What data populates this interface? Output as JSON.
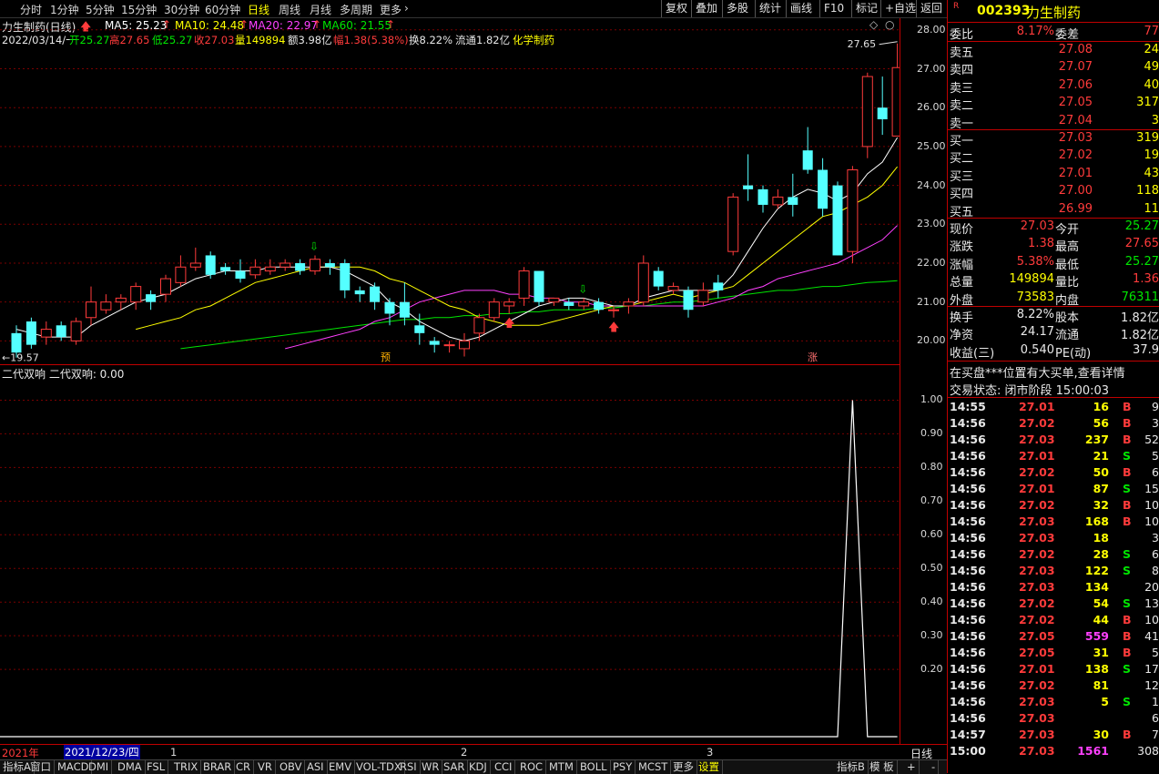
{
  "periods": [
    "分时",
    "1分钟",
    "5分钟",
    "15分钟",
    "30分钟",
    "60分钟",
    "日线",
    "周线",
    "月线",
    "多周期",
    "更多"
  ],
  "active_period": "日线",
  "tools": [
    "复权",
    "叠加",
    "多股",
    "统计",
    "画线",
    "F10",
    "标记",
    "+自选",
    "返回"
  ],
  "stock": {
    "code": "002393",
    "name": "力生制药",
    "badge": "R",
    "title": "力生制药(日线)"
  },
  "ma_line": {
    "ma5": "MA5: 25.23",
    "ma10": "MA10: 24.48",
    "ma20": "MA20: 22.97",
    "ma60": "MA60: 21.55"
  },
  "info_line": {
    "date": "2022/03/14/一",
    "open": "开25.27",
    "high": "高27.65",
    "low": "低25.27",
    "close": "收27.03",
    "vol": "量149894",
    "amt": "额3.98亿",
    "chg": "幅1.38(5.38%)",
    "turn": "换8.22%",
    "float": "流通1.82亿",
    "sector": "化学制药"
  },
  "kline_axis": [
    "28.00",
    "27.00",
    "26.00",
    "25.00",
    "24.00",
    "23.00",
    "22.00",
    "21.00",
    "20.00"
  ],
  "kline_annotations": {
    "high_label": "27.65",
    "low_label": "19.57",
    "pre": "预",
    "rise": "涨"
  },
  "indicator": {
    "title": "二代双响  二代双响: 0.00",
    "axis": [
      "1.00",
      "0.90",
      "0.80",
      "0.70",
      "0.60",
      "0.50",
      "0.40",
      "0.30",
      "0.20"
    ]
  },
  "date_bar": {
    "year": "2021年",
    "cursor_date": "2021/12/23/四",
    "m1": "1",
    "m2": "2",
    "m3": "3",
    "period": "日线"
  },
  "bottom_tabs": [
    "指标A",
    "窗口",
    "MACD",
    "DMI",
    "DMA",
    "FSL",
    "TRIX",
    "BRAR",
    "CR",
    "VR",
    "OBV",
    "ASI",
    "EMV",
    "VOL-TDX",
    "RSI",
    "WR",
    "SAR",
    "KDJ",
    "CCI",
    "ROC",
    "MTM",
    "BOLL",
    "PSY",
    "MCST",
    "更多",
    "设置"
  ],
  "bottom_right": [
    "指标B",
    "模 板",
    "+",
    "-"
  ],
  "order_book": {
    "weibi_label": "委比",
    "weibi": "8.17%",
    "weicha_label": "委差",
    "weicha": "77",
    "asks": [
      {
        "l": "卖五",
        "p": "27.08",
        "v": "24"
      },
      {
        "l": "卖四",
        "p": "27.07",
        "v": "49"
      },
      {
        "l": "卖三",
        "p": "27.06",
        "v": "40"
      },
      {
        "l": "卖二",
        "p": "27.05",
        "v": "317"
      },
      {
        "l": "卖一",
        "p": "27.04",
        "v": "3"
      }
    ],
    "bids": [
      {
        "l": "买一",
        "p": "27.03",
        "v": "319"
      },
      {
        "l": "买二",
        "p": "27.02",
        "v": "19"
      },
      {
        "l": "买三",
        "p": "27.01",
        "v": "43"
      },
      {
        "l": "买四",
        "p": "27.00",
        "v": "118"
      },
      {
        "l": "买五",
        "p": "26.99",
        "v": "11"
      }
    ]
  },
  "quote": [
    {
      "l1": "现价",
      "v1": "27.03",
      "l2": "今开",
      "v2": "25.27"
    },
    {
      "l1": "涨跌",
      "v1": "1.38",
      "l2": "最高",
      "v2": "27.65"
    },
    {
      "l1": "涨幅",
      "v1": "5.38%",
      "l2": "最低",
      "v2": "25.27"
    },
    {
      "l1": "总量",
      "v1": "149894",
      "l2": "量比",
      "v2": "1.36"
    },
    {
      "l1": "外盘",
      "v1": "73583",
      "l2": "内盘",
      "v2": "76311"
    }
  ],
  "fund": [
    {
      "l1": "换手",
      "v1": "8.22%",
      "l2": "股本",
      "v2": "1.82亿"
    },
    {
      "l1": "净资",
      "v1": "24.17",
      "l2": "流通",
      "v2": "1.82亿"
    },
    {
      "l1": "收益(三)",
      "v1": "0.540",
      "l2": "PE(动)",
      "v2": "37.9"
    }
  ],
  "notice": "在买盘***位置有大买单,查看详情",
  "trade_status": "交易状态: 闭市阶段 15:00:03",
  "ticks": [
    {
      "t": "14:55",
      "p": "27.01",
      "v": "16",
      "d": "B",
      "n": "9"
    },
    {
      "t": "14:56",
      "p": "27.02",
      "v": "56",
      "d": "B",
      "n": "3"
    },
    {
      "t": "14:56",
      "p": "27.03",
      "v": "237",
      "d": "B",
      "n": "52"
    },
    {
      "t": "14:56",
      "p": "27.01",
      "v": "21",
      "d": "S",
      "n": "5"
    },
    {
      "t": "14:56",
      "p": "27.02",
      "v": "50",
      "d": "B",
      "n": "6"
    },
    {
      "t": "14:56",
      "p": "27.01",
      "v": "87",
      "d": "S",
      "n": "15"
    },
    {
      "t": "14:56",
      "p": "27.02",
      "v": "32",
      "d": "B",
      "n": "10"
    },
    {
      "t": "14:56",
      "p": "27.03",
      "v": "168",
      "d": "B",
      "n": "10"
    },
    {
      "t": "14:56",
      "p": "27.03",
      "v": "18",
      "d": "",
      "n": "3"
    },
    {
      "t": "14:56",
      "p": "27.02",
      "v": "28",
      "d": "S",
      "n": "6"
    },
    {
      "t": "14:56",
      "p": "27.03",
      "v": "122",
      "d": "S",
      "n": "8"
    },
    {
      "t": "14:56",
      "p": "27.03",
      "v": "134",
      "d": "",
      "n": "20"
    },
    {
      "t": "14:56",
      "p": "27.02",
      "v": "54",
      "d": "S",
      "n": "13"
    },
    {
      "t": "14:56",
      "p": "27.02",
      "v": "44",
      "d": "B",
      "n": "10"
    },
    {
      "t": "14:56",
      "p": "27.05",
      "v": "559",
      "d": "B",
      "n": "41"
    },
    {
      "t": "14:56",
      "p": "27.05",
      "v": "31",
      "d": "B",
      "n": "5"
    },
    {
      "t": "14:56",
      "p": "27.01",
      "v": "138",
      "d": "S",
      "n": "17"
    },
    {
      "t": "14:56",
      "p": "27.02",
      "v": "81",
      "d": "",
      "n": "12"
    },
    {
      "t": "14:56",
      "p": "27.03",
      "v": "5",
      "d": "S",
      "n": "1"
    },
    {
      "t": "14:56",
      "p": "27.03",
      "v": "",
      "d": "",
      "n": "6"
    },
    {
      "t": "14:57",
      "p": "27.03",
      "v": "30",
      "d": "B",
      "n": "7"
    },
    {
      "t": "15:00",
      "p": "27.03",
      "v": "1561",
      "d": "",
      "n": "308"
    }
  ],
  "colors": {
    "up": "#ff3b3b",
    "down": "#54ffff",
    "ma5": "#ffffff",
    "ma10": "#ffff00",
    "ma20": "#ff40ff",
    "ma60": "#00e600"
  },
  "chart_data": {
    "type": "candlestick",
    "title": "力生制药(日线)",
    "ylim": [
      19.4,
      28.3
    ],
    "candles": [
      {
        "o": 20.2,
        "c": 19.7,
        "h": 20.4,
        "l": 19.57
      },
      {
        "o": 20.5,
        "c": 19.9,
        "h": 20.6,
        "l": 19.8
      },
      {
        "o": 20.1,
        "c": 20.3,
        "h": 20.5,
        "l": 19.9
      },
      {
        "o": 20.4,
        "c": 20.1,
        "h": 20.5,
        "l": 20.0
      },
      {
        "o": 20.0,
        "c": 20.5,
        "h": 20.6,
        "l": 19.9
      },
      {
        "o": 20.6,
        "c": 21.0,
        "h": 21.4,
        "l": 20.4
      },
      {
        "o": 20.8,
        "c": 21.0,
        "h": 21.2,
        "l": 20.7
      },
      {
        "o": 21.0,
        "c": 21.1,
        "h": 21.2,
        "l": 20.8
      },
      {
        "o": 21.0,
        "c": 21.4,
        "h": 21.5,
        "l": 20.8
      },
      {
        "o": 21.2,
        "c": 21.0,
        "h": 21.3,
        "l": 20.8
      },
      {
        "o": 21.2,
        "c": 21.6,
        "h": 21.7,
        "l": 21.0
      },
      {
        "o": 21.5,
        "c": 21.9,
        "h": 22.2,
        "l": 21.4
      },
      {
        "o": 21.9,
        "c": 22.0,
        "h": 22.4,
        "l": 21.8
      },
      {
        "o": 22.2,
        "c": 21.7,
        "h": 22.3,
        "l": 21.6
      },
      {
        "o": 21.9,
        "c": 21.8,
        "h": 22.0,
        "l": 21.7
      },
      {
        "o": 21.8,
        "c": 21.6,
        "h": 22.1,
        "l": 21.5
      },
      {
        "o": 21.7,
        "c": 21.9,
        "h": 22.1,
        "l": 21.6
      },
      {
        "o": 21.8,
        "c": 21.9,
        "h": 22.1,
        "l": 21.7
      },
      {
        "o": 21.9,
        "c": 22.0,
        "h": 22.1,
        "l": 21.8
      },
      {
        "o": 22.0,
        "c": 21.8,
        "h": 22.1,
        "l": 21.7
      },
      {
        "o": 21.8,
        "c": 22.1,
        "h": 22.2,
        "l": 21.7
      },
      {
        "o": 22.0,
        "c": 21.9,
        "h": 22.1,
        "l": 21.7
      },
      {
        "o": 22.0,
        "c": 21.3,
        "h": 22.1,
        "l": 21.1
      },
      {
        "o": 21.3,
        "c": 21.2,
        "h": 21.4,
        "l": 21.0
      },
      {
        "o": 21.4,
        "c": 21.0,
        "h": 21.5,
        "l": 20.8
      },
      {
        "o": 21.0,
        "c": 20.7,
        "h": 21.1,
        "l": 20.4
      },
      {
        "o": 21.0,
        "c": 20.6,
        "h": 21.5,
        "l": 20.4
      },
      {
        "o": 20.4,
        "c": 20.2,
        "h": 20.7,
        "l": 19.9
      },
      {
        "o": 20.0,
        "c": 19.9,
        "h": 20.1,
        "l": 19.7
      },
      {
        "o": 19.9,
        "c": 19.9,
        "h": 20.0,
        "l": 19.7
      },
      {
        "o": 19.8,
        "c": 20.0,
        "h": 20.2,
        "l": 19.6
      },
      {
        "o": 20.2,
        "c": 20.6,
        "h": 20.7,
        "l": 20.0
      },
      {
        "o": 20.6,
        "c": 21.0,
        "h": 21.1,
        "l": 20.5
      },
      {
        "o": 20.9,
        "c": 21.0,
        "h": 21.1,
        "l": 20.7
      },
      {
        "o": 21.1,
        "c": 21.8,
        "h": 21.9,
        "l": 20.9
      },
      {
        "o": 21.8,
        "c": 21.0,
        "h": 21.8,
        "l": 20.9
      },
      {
        "o": 21.0,
        "c": 21.1,
        "h": 21.1,
        "l": 20.9
      },
      {
        "o": 21.0,
        "c": 20.9,
        "h": 21.1,
        "l": 20.8
      },
      {
        "o": 20.9,
        "c": 21.0,
        "h": 21.1,
        "l": 20.8
      },
      {
        "o": 21.0,
        "c": 20.8,
        "h": 21.1,
        "l": 20.7
      },
      {
        "o": 20.8,
        "c": 20.8,
        "h": 20.9,
        "l": 20.6
      },
      {
        "o": 20.9,
        "c": 21.0,
        "h": 21.1,
        "l": 20.7
      },
      {
        "o": 21.0,
        "c": 22.0,
        "h": 22.2,
        "l": 20.9
      },
      {
        "o": 21.8,
        "c": 21.4,
        "h": 21.9,
        "l": 21.3
      },
      {
        "o": 21.3,
        "c": 21.4,
        "h": 21.5,
        "l": 21.2
      },
      {
        "o": 21.3,
        "c": 20.8,
        "h": 21.4,
        "l": 20.6
      },
      {
        "o": 21.0,
        "c": 21.3,
        "h": 21.5,
        "l": 20.9
      },
      {
        "o": 21.5,
        "c": 21.3,
        "h": 21.7,
        "l": 21.1
      },
      {
        "o": 22.3,
        "c": 23.7,
        "h": 23.8,
        "l": 22.2
      },
      {
        "o": 24.0,
        "c": 23.9,
        "h": 24.8,
        "l": 23.6
      },
      {
        "o": 23.9,
        "c": 23.5,
        "h": 24.0,
        "l": 23.3
      },
      {
        "o": 23.5,
        "c": 23.7,
        "h": 23.9,
        "l": 23.4
      },
      {
        "o": 23.7,
        "c": 23.5,
        "h": 24.3,
        "l": 23.2
      },
      {
        "o": 24.9,
        "c": 24.4,
        "h": 25.5,
        "l": 24.3
      },
      {
        "o": 24.4,
        "c": 23.4,
        "h": 24.7,
        "l": 23.2
      },
      {
        "o": 24.0,
        "c": 22.2,
        "h": 24.1,
        "l": 22.2
      },
      {
        "o": 22.3,
        "c": 24.4,
        "h": 24.5,
        "l": 22.0
      },
      {
        "o": 25.0,
        "c": 26.8,
        "h": 26.9,
        "l": 24.7
      },
      {
        "o": 26.0,
        "c": 25.7,
        "h": 26.8,
        "l": 25.3
      },
      {
        "o": 25.27,
        "c": 27.03,
        "h": 27.65,
        "l": 25.27
      }
    ],
    "ma5": [
      20.3,
      20.2,
      20.1,
      20.1,
      20.1,
      20.4,
      20.6,
      20.8,
      21.0,
      21.1,
      21.2,
      21.4,
      21.6,
      21.7,
      21.8,
      21.8,
      21.8,
      21.9,
      21.9,
      21.9,
      21.9,
      21.9,
      21.8,
      21.6,
      21.4,
      21.0,
      20.8,
      20.5,
      20.3,
      20.1,
      20.0,
      20.1,
      20.3,
      20.5,
      20.7,
      20.9,
      21.0,
      21.1,
      21.1,
      21.0,
      20.9,
      20.9,
      21.1,
      21.2,
      21.3,
      21.3,
      21.3,
      21.3,
      21.7,
      22.3,
      22.9,
      23.4,
      23.7,
      23.9,
      23.8,
      23.6,
      23.8,
      24.3,
      24.6,
      25.23
    ],
    "ma10": [
      null,
      null,
      null,
      null,
      null,
      null,
      null,
      null,
      20.3,
      20.4,
      20.5,
      20.6,
      20.8,
      20.9,
      21.1,
      21.3,
      21.5,
      21.6,
      21.7,
      21.8,
      21.9,
      21.9,
      21.9,
      21.9,
      21.8,
      21.6,
      21.5,
      21.3,
      21.1,
      20.9,
      20.8,
      20.6,
      20.5,
      20.4,
      20.4,
      20.4,
      20.5,
      20.6,
      20.7,
      20.8,
      20.9,
      20.9,
      21.0,
      21.1,
      21.2,
      21.1,
      21.2,
      21.3,
      21.4,
      21.7,
      22.0,
      22.3,
      22.6,
      22.9,
      23.2,
      23.3,
      23.5,
      23.7,
      24.0,
      24.48
    ],
    "ma20": [
      null,
      null,
      null,
      null,
      null,
      null,
      null,
      null,
      null,
      null,
      null,
      null,
      null,
      null,
      null,
      null,
      null,
      null,
      19.8,
      19.9,
      20.0,
      20.1,
      20.2,
      20.3,
      20.5,
      20.6,
      20.8,
      21.0,
      21.1,
      21.2,
      21.3,
      21.3,
      21.3,
      21.2,
      21.2,
      21.1,
      21.1,
      21.0,
      21.0,
      20.9,
      20.9,
      20.9,
      20.9,
      20.9,
      20.9,
      20.9,
      20.9,
      21.0,
      21.1,
      21.3,
      21.4,
      21.6,
      21.7,
      21.8,
      21.9,
      22.0,
      22.2,
      22.4,
      22.6,
      22.97
    ],
    "ma60": [
      null,
      null,
      null,
      null,
      null,
      null,
      null,
      null,
      null,
      null,
      null,
      19.8,
      19.85,
      19.9,
      19.95,
      20.0,
      20.05,
      20.1,
      20.15,
      20.2,
      20.25,
      20.3,
      20.35,
      20.4,
      20.45,
      20.5,
      20.55,
      20.55,
      20.6,
      20.6,
      20.65,
      20.65,
      20.7,
      20.7,
      20.75,
      20.75,
      20.8,
      20.8,
      20.8,
      20.85,
      20.85,
      20.9,
      20.9,
      20.95,
      21.0,
      21.0,
      21.05,
      21.1,
      21.15,
      21.2,
      21.25,
      21.3,
      21.3,
      21.35,
      21.4,
      21.4,
      21.45,
      21.5,
      21.52,
      21.55
    ],
    "signals": {
      "down_arrow": [
        20,
        38
      ],
      "up_arrow_red": [
        33,
        40
      ]
    },
    "indicator_series": {
      "name": "二代双响",
      "values": [
        0,
        0,
        0,
        0,
        0,
        0,
        0,
        0,
        0,
        0,
        0,
        0,
        0,
        0,
        0,
        0,
        0,
        0,
        0,
        0,
        0,
        0,
        0,
        0,
        0,
        0,
        0,
        0,
        0,
        0,
        0,
        0,
        0,
        0,
        0,
        0,
        0,
        0,
        0,
        0,
        0,
        0,
        0,
        0,
        0,
        0,
        0,
        0,
        0,
        0,
        0,
        0,
        0,
        0,
        0,
        0,
        1,
        0,
        0,
        0
      ],
      "ylim": [
        0,
        1.05
      ]
    }
  }
}
